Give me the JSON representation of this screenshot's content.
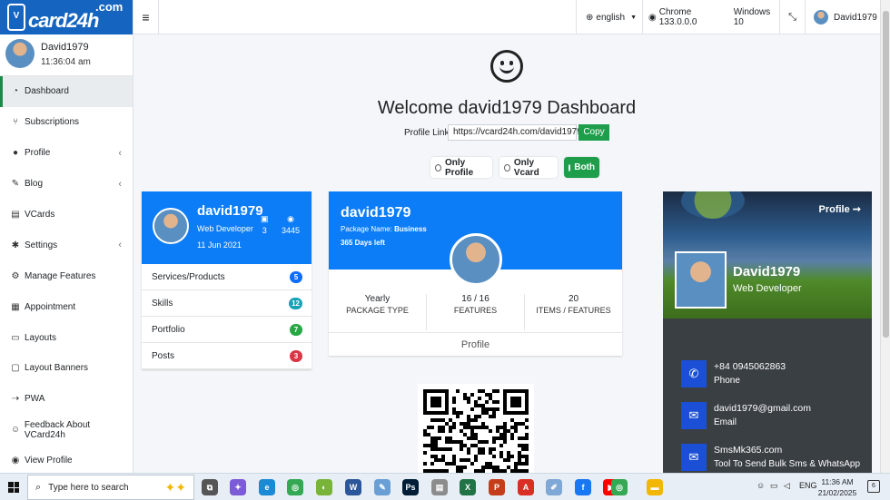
{
  "logo": {
    "mark": "V",
    "brand": "card24h",
    "tld": ".com"
  },
  "user": {
    "name": "David1979",
    "time": "11:36:04 am"
  },
  "nav": [
    {
      "label": "Dashboard",
      "icon": "dashboard-icon",
      "glyph": "◔",
      "chevron": false,
      "active": true
    },
    {
      "label": "Subscriptions",
      "icon": "subscriptions-icon",
      "glyph": "⑂",
      "chevron": false,
      "active": false
    },
    {
      "label": "Profile",
      "icon": "profile-icon",
      "glyph": "●",
      "chevron": true,
      "active": false
    },
    {
      "label": "Blog",
      "icon": "blog-icon",
      "glyph": "✎",
      "chevron": true,
      "active": false
    },
    {
      "label": "VCards",
      "icon": "vcards-icon",
      "glyph": "▤",
      "chevron": false,
      "active": false
    },
    {
      "label": "Settings",
      "icon": "settings-icon",
      "glyph": "✱",
      "chevron": true,
      "active": false
    },
    {
      "label": "Manage Features",
      "icon": "manage-features-icon",
      "glyph": "⚙",
      "chevron": false,
      "active": false
    },
    {
      "label": "Appointment",
      "icon": "calendar-icon",
      "glyph": "▦",
      "chevron": false,
      "active": false
    },
    {
      "label": "Layouts",
      "icon": "laptop-icon",
      "glyph": "▭",
      "chevron": false,
      "active": false
    },
    {
      "label": "Layout Banners",
      "icon": "banner-icon",
      "glyph": "▢",
      "chevron": false,
      "active": false
    },
    {
      "label": "PWA",
      "icon": "pwa-icon",
      "glyph": "⇢",
      "chevron": false,
      "active": false
    },
    {
      "label": "Feedback About VCard24h",
      "icon": "feedback-icon",
      "glyph": "☺",
      "chevron": false,
      "active": false
    },
    {
      "label": "View Profile",
      "icon": "view-profile-icon",
      "glyph": "◉",
      "chevron": false,
      "active": false
    }
  ],
  "topbar": {
    "menu_glyph": "≡",
    "language": "english",
    "browser": "Chrome 133.0.0.0",
    "os": "Windows 10",
    "user": "David1979"
  },
  "welcome": {
    "title": "Welcome david1979 Dashboard",
    "profile_link_label": "Profile Link:",
    "profile_link": "https://vcard24h.com/david1979",
    "copy_label": "Copy",
    "options": [
      {
        "label": "Only Profile",
        "selected": false
      },
      {
        "label": "Only Vcard",
        "selected": false
      },
      {
        "label": "Both",
        "selected": true
      }
    ]
  },
  "profile_card": {
    "name": "david1979",
    "role": "Web Developer",
    "date": "11 Jun 2021",
    "saves": "3",
    "views": "3445",
    "items": [
      {
        "label": "Services/Products",
        "count": "5",
        "color": "#0d6efd"
      },
      {
        "label": "Skills",
        "count": "12",
        "color": "#17a2b8"
      },
      {
        "label": "Portfolio",
        "count": "7",
        "color": "#28a745"
      },
      {
        "label": "Posts",
        "count": "3",
        "color": "#dc3545"
      }
    ]
  },
  "package_card": {
    "name": "david1979",
    "package_prefix": "Package Name: ",
    "package_name": "Business",
    "days_left": "365 Days left",
    "stats": [
      {
        "value": "Yearly",
        "label": "PACKAGE TYPE"
      },
      {
        "value": "16 / 16",
        "label": "FEATURES"
      },
      {
        "value": "20",
        "label": "ITEMS / FEATURES"
      }
    ],
    "footer": "Profile"
  },
  "vcard": {
    "profile_link": "Profile ➞",
    "name": "David1979",
    "role": "Web Developer",
    "contacts": [
      {
        "icon": "phone-icon",
        "glyph": "✆",
        "value": "+84 0945062863",
        "label": "Phone"
      },
      {
        "icon": "email-icon",
        "glyph": "✉",
        "value": "david1979@gmail.com",
        "label": "Email"
      },
      {
        "icon": "chat-icon",
        "glyph": "✉",
        "value": "SmsMk365.com",
        "label": "Tool To Send Bulk Sms & WhatsApp"
      }
    ]
  },
  "taskbar": {
    "search_placeholder": "Type here to search",
    "clock_time": "11:36 AM",
    "clock_date": "21/02/2025",
    "lang": "ENG",
    "notif_count": "6",
    "apps": [
      {
        "name": "task-view-icon",
        "color": "#555555",
        "glyph": "⧉"
      },
      {
        "name": "copilot-icon",
        "color": "#7b5cd6",
        "glyph": "✦"
      },
      {
        "name": "edge-icon",
        "color": "#1b8ad6",
        "glyph": "e"
      },
      {
        "name": "chrome-icon",
        "color": "#34a853",
        "glyph": "◎"
      },
      {
        "name": "app-green-icon",
        "color": "#78b33a",
        "glyph": "◐"
      },
      {
        "name": "word-icon",
        "color": "#2b579a",
        "glyph": "W"
      },
      {
        "name": "paint-icon",
        "color": "#6a9fd6",
        "glyph": "✎"
      },
      {
        "name": "photoshop-icon",
        "color": "#001e36",
        "glyph": "Ps"
      },
      {
        "name": "file-icon",
        "color": "#8c8c8c",
        "glyph": "▤"
      },
      {
        "name": "excel-icon",
        "color": "#217346",
        "glyph": "X"
      },
      {
        "name": "powerpoint-icon",
        "color": "#c43e1c",
        "glyph": "P"
      },
      {
        "name": "pdf-icon",
        "color": "#d93025",
        "glyph": "A"
      },
      {
        "name": "paint3d-icon",
        "color": "#7fa8d6",
        "glyph": "✐"
      },
      {
        "name": "facebook-icon",
        "color": "#1877f2",
        "glyph": "f"
      },
      {
        "name": "youtube-icon",
        "color": "#ff0000",
        "glyph": "▶"
      },
      {
        "name": "chrome-active-icon",
        "color": "#34a853",
        "glyph": "◎"
      },
      {
        "name": "explorer-icon",
        "color": "#f2b705",
        "glyph": "▬"
      }
    ]
  }
}
